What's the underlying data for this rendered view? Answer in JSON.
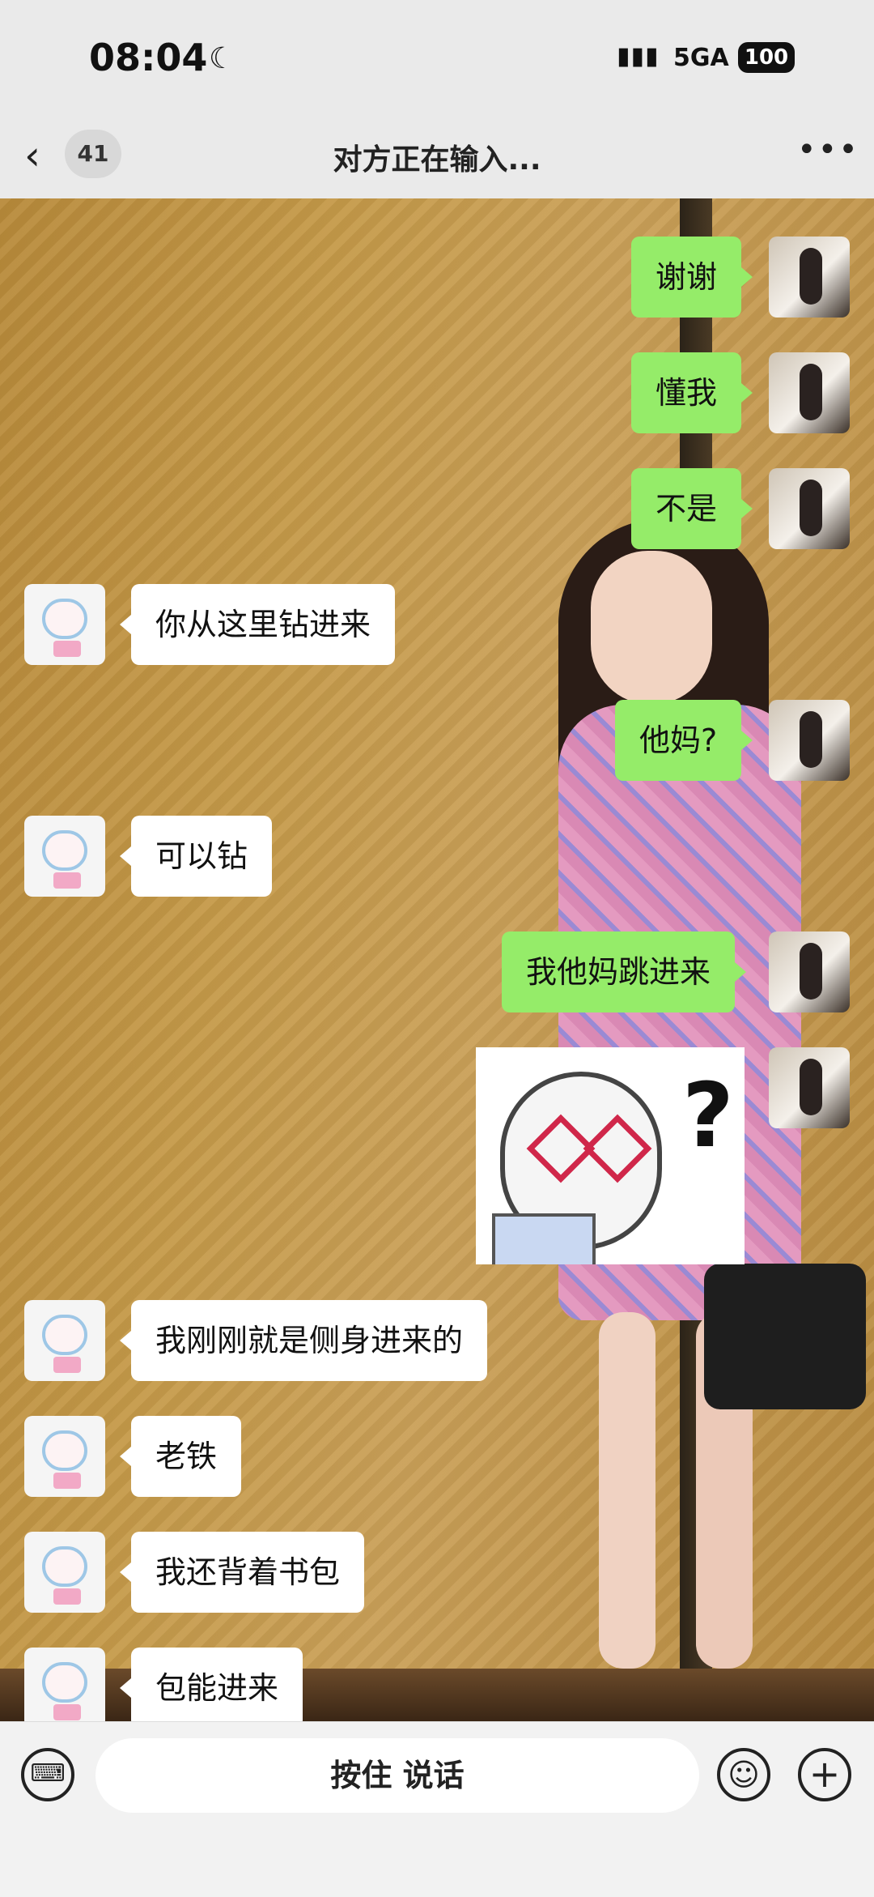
{
  "status_bar": {
    "time": "08:04",
    "network": "5GA",
    "battery": "100"
  },
  "header": {
    "unread_count": "41",
    "title": "对方正在输入..."
  },
  "messages": [
    {
      "from": "me",
      "text": "谢谢"
    },
    {
      "from": "me",
      "text": "懂我"
    },
    {
      "from": "me",
      "text": "不是"
    },
    {
      "from": "them",
      "text": "你从这里钻进来"
    },
    {
      "from": "me",
      "text": "他妈?"
    },
    {
      "from": "them",
      "text": "可以钻"
    },
    {
      "from": "me",
      "text": "我他妈跳进来"
    },
    {
      "from": "me",
      "type": "sticker",
      "icon": "confused-glasses-face-sticker"
    },
    {
      "from": "them",
      "text": "我刚刚就是侧身进来的"
    },
    {
      "from": "them",
      "text": "老铁"
    },
    {
      "from": "them",
      "text": "我还背着书包"
    },
    {
      "from": "them",
      "text": "包能进来"
    }
  ],
  "input_bar": {
    "hold_to_talk": "按住 说话"
  },
  "colors": {
    "my_bubble": "#95ec69",
    "their_bubble": "#ffffff",
    "bar_bg": "#eaeaea"
  }
}
